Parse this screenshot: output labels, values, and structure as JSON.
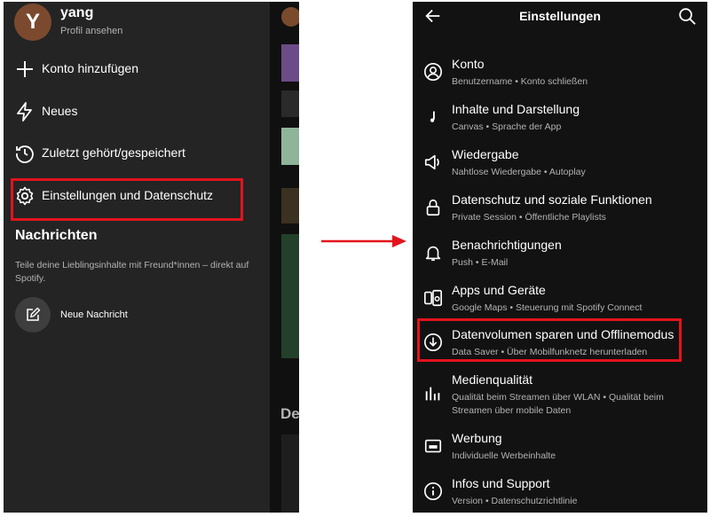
{
  "left": {
    "profile": {
      "initial": "Y",
      "name": "yang",
      "subtitle": "Profil ansehen"
    },
    "menu": [
      {
        "label": "Konto hinzufügen",
        "icon": "plus-icon"
      },
      {
        "label": "Neues",
        "icon": "lightning-icon"
      },
      {
        "label": "Zuletzt gehört/gespeichert",
        "icon": "history-icon"
      },
      {
        "label": "Einstellungen und Datenschutz",
        "icon": "gear-icon",
        "highlighted": true
      }
    ],
    "messages": {
      "title": "Nachrichten",
      "description": "Teile deine Lieblingsinhalte mit Freund*innen – direkt auf Spotify.",
      "new_message": "Neue Nachricht"
    },
    "background_peek_text": "De"
  },
  "right": {
    "title": "Einstellungen",
    "items": [
      {
        "title": "Konto",
        "subtitle": "Benutzername • Konto schließen",
        "icon": "account-icon"
      },
      {
        "title": "Inhalte und Darstellung",
        "subtitle": "Canvas • Sprache der App",
        "icon": "music-note-icon"
      },
      {
        "title": "Wiedergabe",
        "subtitle": "Nahtlose Wiedergabe • Autoplay",
        "icon": "speaker-icon"
      },
      {
        "title": "Datenschutz und soziale Funktionen",
        "subtitle": "Private Session • Öffentliche Playlists",
        "icon": "lock-icon"
      },
      {
        "title": "Benachrichtigungen",
        "subtitle": "Push • E-Mail",
        "icon": "bell-icon"
      },
      {
        "title": "Apps und Geräte",
        "subtitle": "Google Maps • Steuerung mit Spotify Connect",
        "icon": "devices-icon"
      },
      {
        "title": "Datenvolumen sparen und Offlinemodus",
        "subtitle": "Data Saver • Über Mobilfunknetz herunterladen",
        "icon": "download-icon",
        "highlighted": true
      },
      {
        "title": "Medienqualität",
        "subtitle": "Qualität beim Streamen über WLAN • Qualität beim Streamen über mobile Daten",
        "icon": "bars-icon"
      },
      {
        "title": "Werbung",
        "subtitle": "Individuelle Werbeinhalte",
        "icon": "ad-icon"
      },
      {
        "title": "Infos und Support",
        "subtitle": "Version • Datenschutzrichtlinie",
        "icon": "info-icon"
      }
    ]
  },
  "colors": {
    "highlight": "#e3131c",
    "panel_bg": "#121212",
    "drawer_bg": "#242424",
    "avatar": "#7b4a2e"
  }
}
